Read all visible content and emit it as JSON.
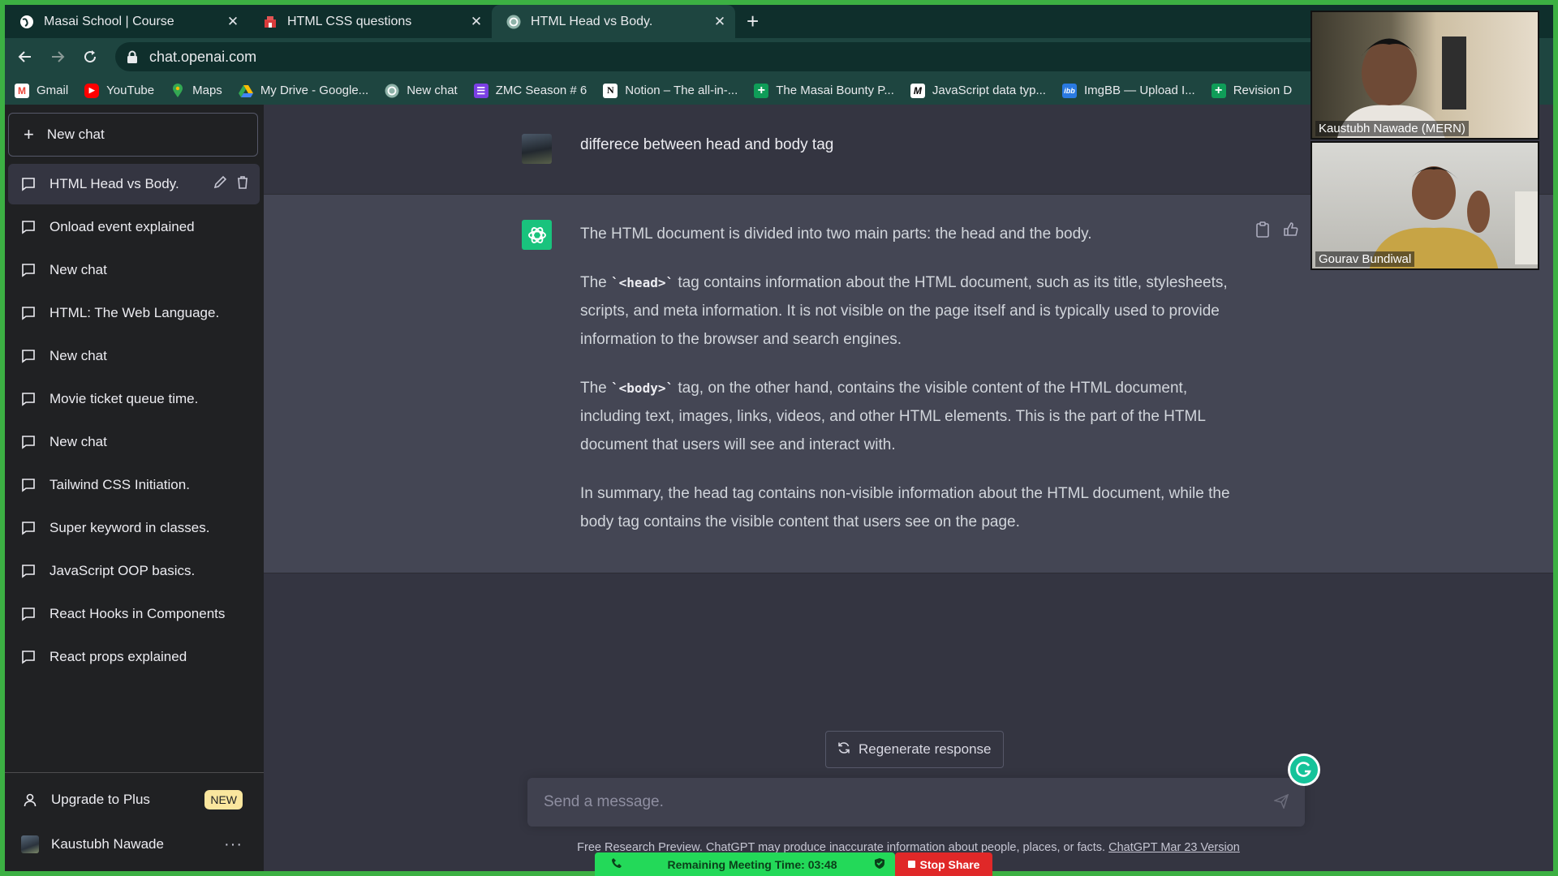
{
  "browser": {
    "tabs": [
      {
        "title": "Masai School | Course",
        "active": false
      },
      {
        "title": "HTML CSS questions",
        "active": false
      },
      {
        "title": "HTML Head vs Body.",
        "active": true
      }
    ],
    "url": "chat.openai.com",
    "bookmarks": [
      {
        "label": "Gmail",
        "icon": "gmail-icon"
      },
      {
        "label": "YouTube",
        "icon": "youtube-icon"
      },
      {
        "label": "Maps",
        "icon": "maps-icon"
      },
      {
        "label": "My Drive - Google...",
        "icon": "drive-icon"
      },
      {
        "label": "New chat",
        "icon": "openai-icon"
      },
      {
        "label": "ZMC Season # 6",
        "icon": "list-icon"
      },
      {
        "label": "Notion – The all-in-...",
        "icon": "notion-icon"
      },
      {
        "label": "The Masai Bounty P...",
        "icon": "plus-icon"
      },
      {
        "label": "JavaScript data typ...",
        "icon": "m-icon"
      },
      {
        "label": "ImgBB — Upload I...",
        "icon": "imgbb-icon"
      },
      {
        "label": "Revision D",
        "icon": "plus-icon"
      }
    ]
  },
  "sidebar": {
    "new_chat": "New chat",
    "history": [
      "HTML Head vs Body.",
      "Onload event explained",
      "New chat",
      "HTML: The Web Language.",
      "New chat",
      "Movie ticket queue time.",
      "New chat",
      "Tailwind CSS Initiation.",
      "Super keyword in classes.",
      "JavaScript OOP basics.",
      "React Hooks in Components",
      "React props explained"
    ],
    "upgrade": "Upgrade to Plus",
    "upgrade_badge": "NEW",
    "user": "Kaustubh Nawade"
  },
  "conversation": {
    "question": "differece between head and body tag",
    "answer": {
      "p1": "The HTML document is divided into two main parts: the head and the body.",
      "p2_pre": "The ",
      "p2_code": "`<head>`",
      "p2_post": " tag contains information about the HTML document, such as its title, stylesheets, scripts, and meta information. It is not visible on the page itself and is typically used to provide information to the browser and search engines.",
      "p3_pre": "The ",
      "p3_code": "`<body>`",
      "p3_post": " tag, on the other hand, contains the visible content of the HTML document, including text, images, links, videos, and other HTML elements. This is the part of the HTML document that users will see and interact with.",
      "p4": "In summary, the head tag contains non-visible information about the HTML document, while the body tag contains the visible content that users see on the page."
    }
  },
  "composer": {
    "regenerate": "Regenerate response",
    "placeholder": "Send a message."
  },
  "footer": {
    "text": "Free Research Preview. ChatGPT may produce inaccurate information about people, places, or facts. ",
    "link": "ChatGPT Mar 23 Version"
  },
  "meeting": {
    "remaining": "Remaining Meeting Time: 03:48",
    "stop_share": "Stop Share",
    "participants": [
      "Kaustubh Nawade (MERN)",
      "Gourav Bundiwal"
    ]
  },
  "colors": {
    "accent": "#19c37d",
    "sidebar": "#202123",
    "answer_bg": "#444654",
    "share_border": "#3cb043"
  }
}
